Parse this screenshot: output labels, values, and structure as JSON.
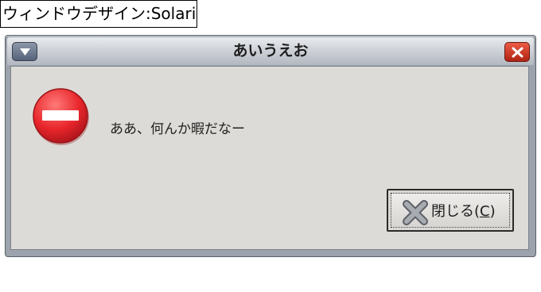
{
  "caption": "ウィンドウデザイン:Solaris",
  "dialog": {
    "title": "あいうえお",
    "message": "ああ、何んか暇だなー",
    "close_button": {
      "text": "閉じる(",
      "mnemonic": "C",
      "text_end": ")"
    }
  },
  "icons": {
    "window_menu": "chevron-down-icon",
    "window_close": "close-icon",
    "message": "stop-icon",
    "button": "close-x-icon"
  },
  "colors": {
    "stop_red": "#e8262b",
    "close_red": "#c93420",
    "dialog_bg": "#dddbd7"
  }
}
